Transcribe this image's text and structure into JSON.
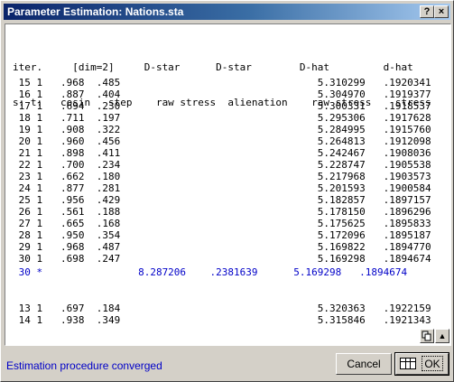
{
  "window": {
    "title": "Parameter Estimation: Nations.sta"
  },
  "titlebar_buttons": {
    "help": "?",
    "close": "×"
  },
  "header": {
    "line1": "iter.     [dim=2]     D-star      D-star        D-hat         d-hat",
    "line2": "s: t:   cosin   step    raw stress  alienation    raw stress    stress"
  },
  "rows_top": [
    " 15 1   .968  .485                                 5.310299   .1920341",
    " 16 1   .887  .404                                 5.304970   .1919377",
    " 17 1   .694  .230                                 5.300331   .1918537",
    " 18 1   .711  .197                                 5.295306   .1917628",
    " 19 1   .908  .322                                 5.284995   .1915760",
    " 20 1   .960  .456                                 5.264813   .1912098",
    " 21 1   .898  .411                                 5.242467   .1908036",
    " 22 1   .700  .234                                 5.228747   .1905538",
    " 23 1   .662  .180                                 5.217968   .1903573",
    " 24 1   .877  .281                                 5.201593   .1900584",
    " 25 1   .956  .429                                 5.182857   .1897157",
    " 26 1   .561  .188                                 5.178150   .1896296",
    " 27 1   .665  .168                                 5.175625   .1895833",
    " 28 1   .950  .354                                 5.172096   .1895187",
    " 29 1   .968  .487                                 5.169822   .1894770",
    " 30 1   .698  .247                                 5.169298   .1894674"
  ],
  "final_row": " 30 *                8.287206    .2381639      5.169298   .1894674",
  "rows_bottom": [
    " 13 1   .697  .184                                 5.320363   .1922159",
    " 14 1   .938  .349                                 5.315846   .1921343"
  ],
  "status": "Estimation procedure converged",
  "buttons": {
    "cancel": "Cancel",
    "ok": "OK"
  },
  "colors": {
    "accent_text": "#0000c8",
    "title_gradient_start": "#0a246a",
    "title_gradient_end": "#a6caf0"
  },
  "icons": {
    "copy": "copy-icon",
    "scroll_up": "scroll-up-icon",
    "grid": "grid-icon"
  }
}
